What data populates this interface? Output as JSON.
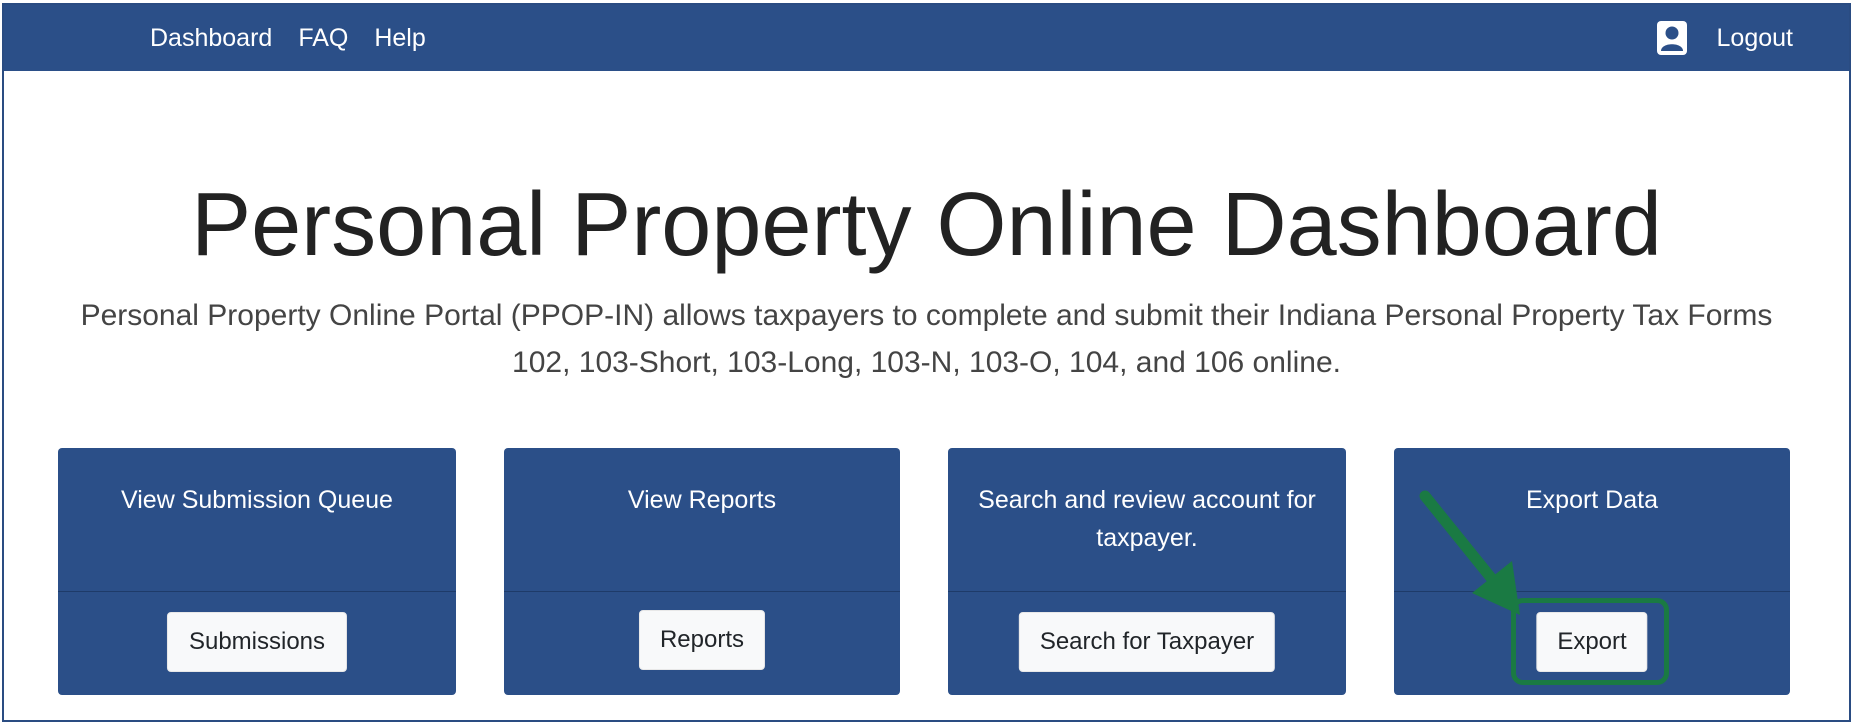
{
  "nav": {
    "links": [
      "Dashboard",
      "FAQ",
      "Help"
    ],
    "logout_label": "Logout"
  },
  "header": {
    "title": "Personal Property Online Dashboard",
    "subtitle": "Personal Property Online Portal (PPOP-IN) allows taxpayers to complete and submit their Indiana Personal Property Tax Forms 102, 103-Short, 103-Long, 103-N, 103-O, 104, and 106 online."
  },
  "cards": [
    {
      "title": "View Submission Queue",
      "button": "Submissions"
    },
    {
      "title": "View Reports",
      "button": "Reports"
    },
    {
      "title": "Search and review account for taxpayer.",
      "button": "Search for Taxpayer"
    },
    {
      "title": "Export Data",
      "button": "Export"
    }
  ],
  "colors": {
    "brand": "#2b4f88",
    "annotation": "#1a7a43"
  },
  "icons": {
    "user": "user-icon",
    "annotation_arrow": "arrow-icon"
  }
}
